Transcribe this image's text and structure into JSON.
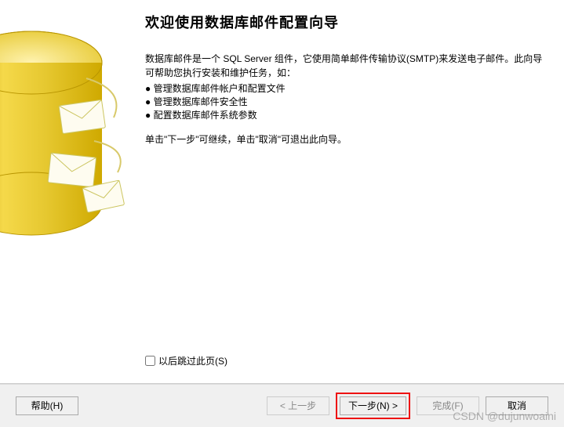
{
  "title": "欢迎使用数据库邮件配置向导",
  "description_line1": "数据库邮件是一个 SQL Server 组件，它使用简单邮件传输协议(SMTP)来发送电子邮件。此向导",
  "description_line2": "可帮助您执行安装和维护任务，如：",
  "bullets": [
    "管理数据库邮件帐户和配置文件",
    "管理数据库邮件安全性",
    "配置数据库邮件系统参数"
  ],
  "instruction": "单击\"下一步\"可继续，单击\"取消\"可退出此向导。",
  "skip_label": "以后跳过此页(S)",
  "buttons": {
    "help": "帮助(H)",
    "back": "< 上一步",
    "next": "下一步(N) >",
    "finish": "完成(F)",
    "cancel": "取消"
  },
  "watermark": "CSDN @dujunwoaini"
}
